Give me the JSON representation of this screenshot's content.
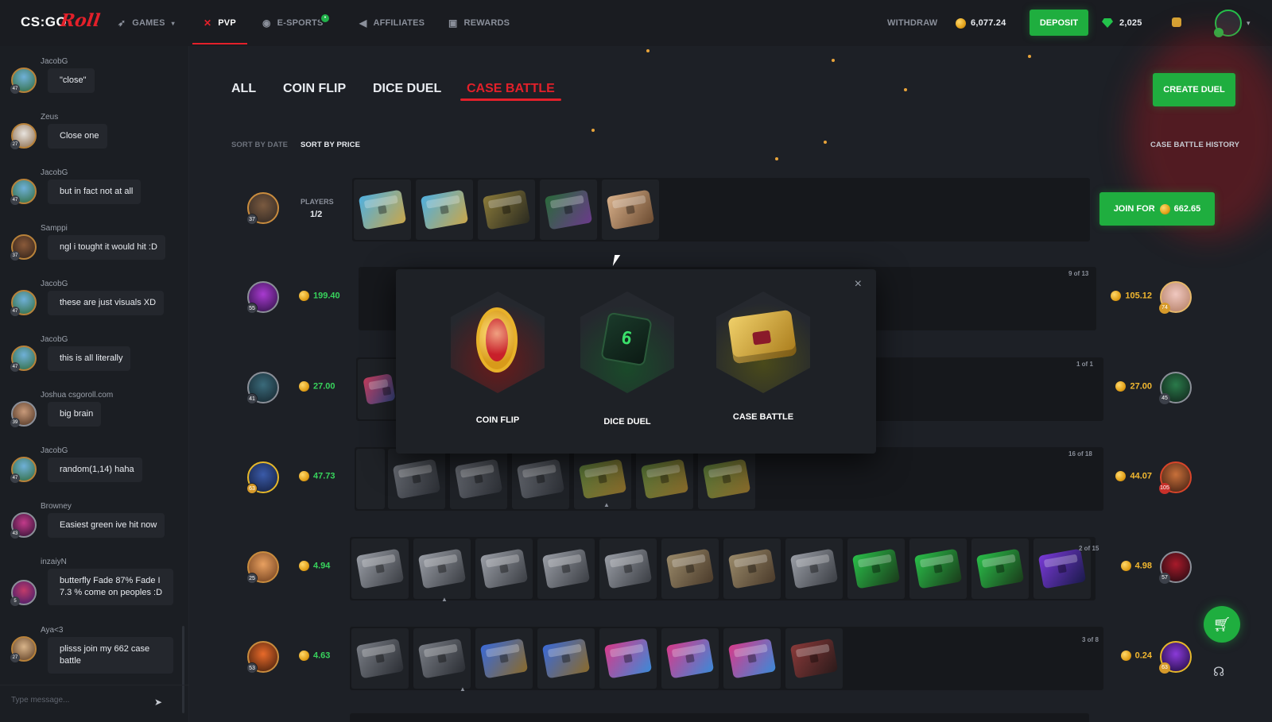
{
  "topbar": {
    "logo_cs": "CS:GO",
    "logo_roll": "Roll",
    "nav": [
      {
        "label": "GAMES",
        "icon": "rocket-icon"
      },
      {
        "label": "PVP",
        "icon": "crossed-swords-icon"
      },
      {
        "label": "E-SPORTS",
        "icon": "gamepad-icon"
      },
      {
        "label": "AFFILIATES",
        "icon": "megaphone-icon"
      },
      {
        "label": "REWARDS",
        "icon": "gift-icon"
      }
    ],
    "withdraw": "WITHDRAW",
    "balance": "6,077.24",
    "deposit": "DEPOSIT",
    "gems": "2,025"
  },
  "chat": {
    "messages": [
      {
        "name": "JacobG",
        "text": "\"close\"",
        "level": "47"
      },
      {
        "name": "Zeus",
        "text": "Close one",
        "level": "27"
      },
      {
        "name": "JacobG",
        "text": "but in fact not at all",
        "level": "47"
      },
      {
        "name": "Samppi",
        "text": "ngl i tought it would hit :D",
        "level": "37"
      },
      {
        "name": "JacobG",
        "text": "these are just visuals XD",
        "level": "47"
      },
      {
        "name": "JacobG",
        "text": "this is all literally",
        "level": "47"
      },
      {
        "name": "Joshua csgoroll.com",
        "text": "big brain",
        "level": "39"
      },
      {
        "name": "JacobG",
        "text": "random(1,14) haha",
        "level": "47"
      },
      {
        "name": "Browney",
        "text": "Easiest green ive hit now",
        "level": "43"
      },
      {
        "name": "inzaiyN",
        "text": "butterfly Fade 87% Fade I 7.3 % come on peoples :D",
        "level": "5"
      },
      {
        "name": "Aya<3",
        "text": "plisss join my 662 case battle",
        "level": "27"
      }
    ],
    "placeholder": "Type message..."
  },
  "main": {
    "tabs": [
      "ALL",
      "COIN FLIP",
      "DICE DUEL",
      "CASE BATTLE"
    ],
    "create_duel": "CREATE DUEL",
    "sort_by_date": "SORT BY DATE",
    "sort_by_price": "SORT BY PRICE",
    "history": "CASE BATTLE HISTORY",
    "first_row": {
      "players_label": "PLAYERS",
      "players": "1/2",
      "join": "JOIN FOR",
      "join_price": "662.65",
      "level": "37"
    },
    "rows": [
      {
        "left_price": "199.40",
        "right_price": "105.12",
        "count": "9 of 13",
        "left_level": "55",
        "right_level": "74"
      },
      {
        "left_price": "27.00",
        "right_price": "27.00",
        "count": "1 of 1",
        "left_level": "41",
        "right_level": "45"
      },
      {
        "left_price": "47.73",
        "right_price": "44.07",
        "count": "16 of 18",
        "left_level": "63",
        "right_level": "105"
      },
      {
        "left_price": "4.94",
        "right_price": "4.98",
        "count": "2 of 15",
        "left_level": "25",
        "right_level": "57"
      },
      {
        "left_price": "4.63",
        "right_price": "0.24",
        "count": "3 of 8",
        "left_level": "53",
        "right_level": "63"
      }
    ]
  },
  "modal": {
    "options": [
      "COIN FLIP",
      "DICE DUEL",
      "CASE BATTLE"
    ],
    "close": "×"
  }
}
